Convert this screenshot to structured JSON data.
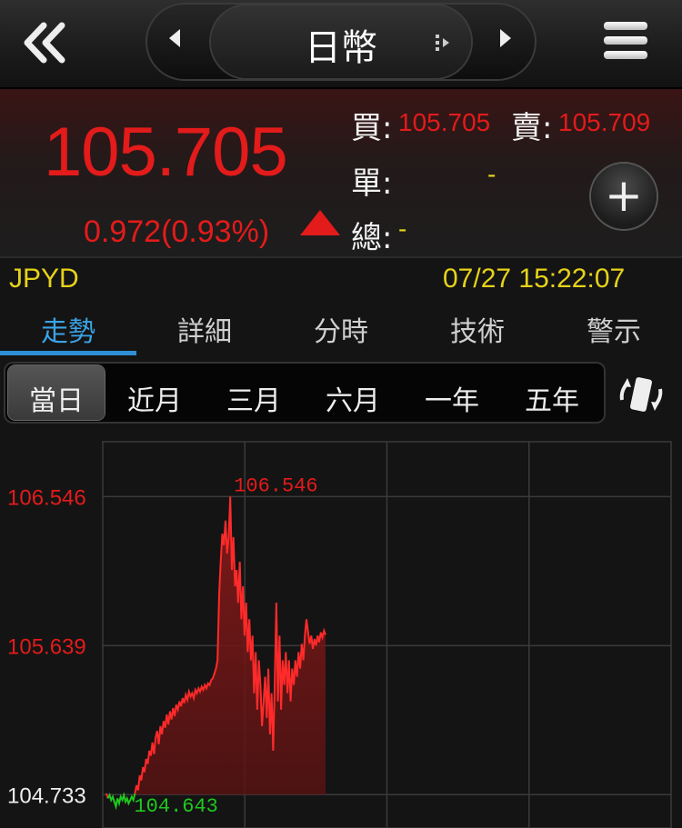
{
  "header": {
    "title": "日幣",
    "icons": [
      "double-chevron-left-icon",
      "triangle-left-icon",
      "triangle-right-icon",
      "drag-handle-icon",
      "hamburger-menu-icon"
    ]
  },
  "quote": {
    "last_price": "105.705",
    "change": "0.972",
    "change_pct": "(0.93%)",
    "buy_label": "買:",
    "buy_value": "105.705",
    "sell_label": "賣:",
    "sell_value": "105.709",
    "volume_label": "單:",
    "volume_value": "-",
    "total_label": "總:",
    "total_value": "-",
    "direction": "up",
    "up_color": "#e31b1b"
  },
  "symbol": "JPYD",
  "datetime": "07/27 15:22:07",
  "tabs": [
    {
      "label": "走勢",
      "active": true
    },
    {
      "label": "詳細",
      "active": false
    },
    {
      "label": "分時",
      "active": false
    },
    {
      "label": "技術",
      "active": false
    },
    {
      "label": "警示",
      "active": false
    }
  ],
  "periods": [
    {
      "label": "當日",
      "active": true
    },
    {
      "label": "近月",
      "active": false
    },
    {
      "label": "三月",
      "active": false
    },
    {
      "label": "六月",
      "active": false
    },
    {
      "label": "一年",
      "active": false
    },
    {
      "label": "五年",
      "active": false
    }
  ],
  "chart_data": {
    "type": "area",
    "title": "",
    "y_ticks": [
      "106.546",
      "105.639",
      "104.733"
    ],
    "ylim": [
      104.53,
      106.88
    ],
    "high_label": "106.546",
    "low_label": "104.643",
    "reference_price": 104.733,
    "grid": true,
    "x_divisions": 4,
    "progress_fraction": 0.4,
    "series": [
      {
        "values": [
          104.74,
          104.71,
          104.73,
          104.7,
          104.72,
          104.69,
          104.66,
          104.71,
          104.68,
          104.72,
          104.7,
          104.73,
          104.69,
          104.71,
          104.68,
          104.7,
          104.72,
          104.7,
          104.74,
          104.79,
          104.76,
          104.85,
          104.82,
          104.9,
          104.87,
          104.95,
          104.92,
          105.0,
          104.97,
          105.05,
          104.98,
          105.08,
          105.12,
          105.04,
          105.15,
          105.1,
          105.18,
          105.14,
          105.22,
          105.16,
          105.24,
          105.19,
          105.26,
          105.21,
          105.28,
          105.25,
          105.3,
          105.27,
          105.32,
          105.29,
          105.34,
          105.31,
          105.36,
          105.33,
          105.35,
          105.32,
          105.37,
          105.35,
          105.38,
          105.36,
          105.39,
          105.37,
          105.4,
          105.38,
          105.41,
          105.4,
          105.43,
          105.44,
          105.47,
          105.5,
          105.55,
          105.95,
          106.15,
          106.32,
          106.25,
          106.4,
          106.2,
          106.3,
          106.546,
          106.1,
          106.3,
          106.0,
          106.1,
          105.9,
          106.15,
          105.8,
          106.0,
          105.7,
          105.9,
          105.6,
          105.8,
          105.55,
          105.7,
          105.35,
          105.6,
          105.25,
          105.55,
          105.4,
          105.15,
          105.3,
          105.45,
          105.2,
          105.5,
          105.1,
          105.35,
          105.0,
          105.4,
          105.9,
          105.3,
          105.7,
          105.25,
          105.55,
          105.4,
          105.6,
          105.35,
          105.55,
          105.3,
          105.5,
          105.4,
          105.55,
          105.45,
          105.6,
          105.5,
          105.65,
          105.55,
          105.7,
          105.8,
          105.72,
          105.65,
          105.7,
          105.62,
          105.68,
          105.64,
          105.7,
          105.66,
          105.72,
          105.69,
          105.73,
          105.705
        ]
      }
    ],
    "line_color": "#ff2a2a",
    "low_color": "#1fc81f",
    "fill_color": "#5a1212"
  }
}
